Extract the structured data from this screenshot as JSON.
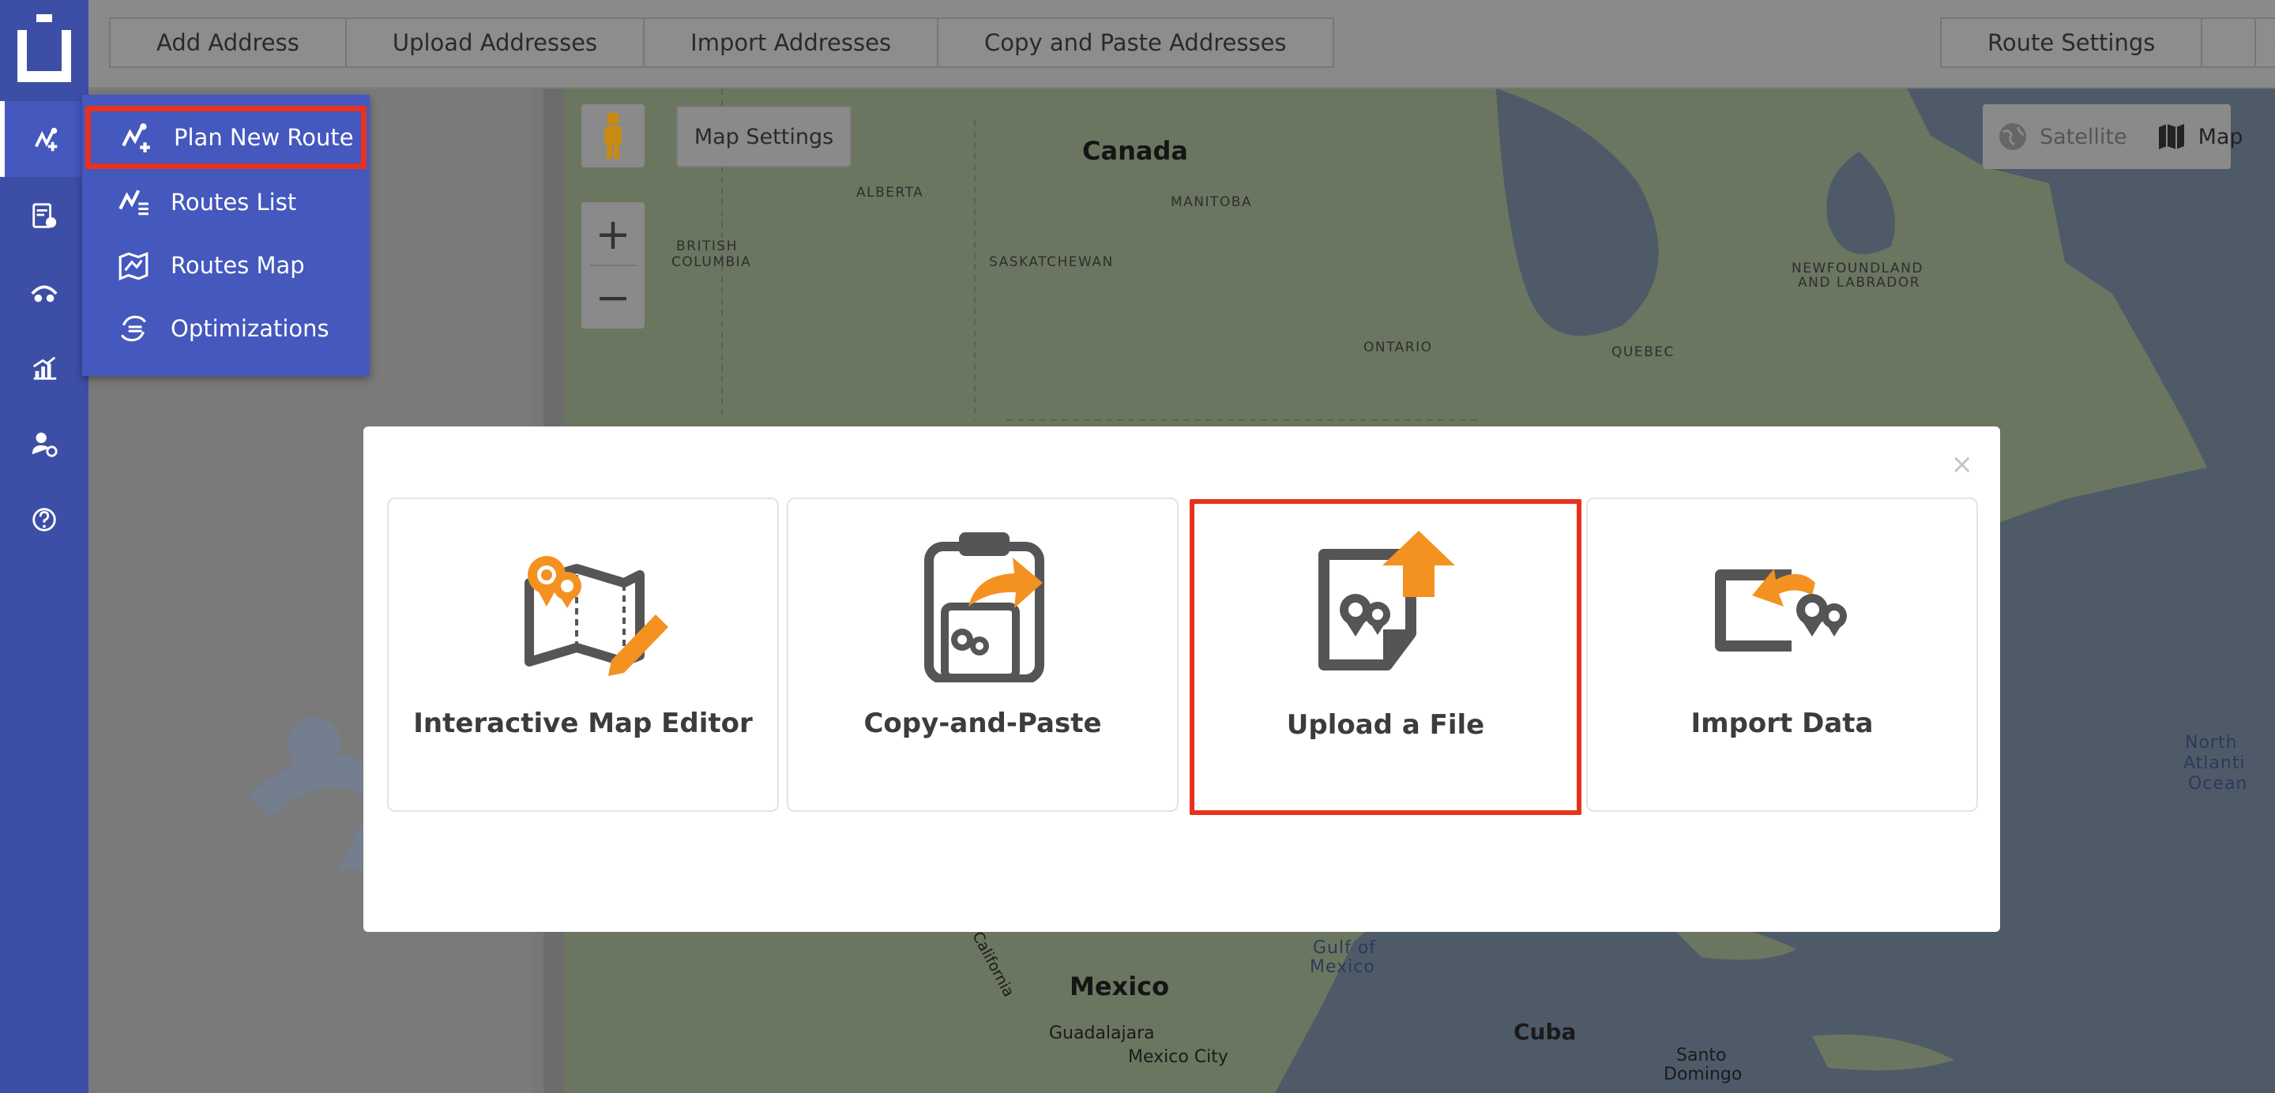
{
  "toolbar": {
    "add_address": "Add Address",
    "upload_addresses": "Upload Addresses",
    "import_addresses": "Import Addresses",
    "copy_paste_addresses": "Copy and Paste Addresses",
    "route_settings": "Route Settings",
    "lightning_icon": "lightning-icon"
  },
  "sidebar": {
    "logo_icon": "route4me-logo-icon",
    "items": [
      {
        "icon": "routes-icon",
        "active": true
      },
      {
        "icon": "address-book-icon",
        "active": false
      },
      {
        "icon": "drivers-icon",
        "active": false
      },
      {
        "icon": "analytics-icon",
        "active": false
      },
      {
        "icon": "user-settings-icon",
        "active": false
      },
      {
        "icon": "help-icon",
        "active": false
      }
    ]
  },
  "dropdown": {
    "items": [
      {
        "label": "Plan New Route",
        "icon": "plan-route-icon",
        "highlighted": true
      },
      {
        "label": "Routes List",
        "icon": "routes-list-icon",
        "highlighted": false
      },
      {
        "label": "Routes Map",
        "icon": "routes-map-icon",
        "highlighted": false
      },
      {
        "label": "Optimizations",
        "icon": "optimizations-icon",
        "highlighted": false
      }
    ]
  },
  "map": {
    "settings_label": "Map Settings",
    "zoom_in": "+",
    "zoom_out": "−",
    "type_satellite": "Satellite",
    "type_map": "Map",
    "labels": {
      "canada": "Canada",
      "alberta": "ALBERTA",
      "manitoba": "MANITOBA",
      "british_columbia_1": "BRITISH",
      "british_columbia_2": "COLUMBIA",
      "saskatchewan": "SASKATCHEWAN",
      "ontario": "ONTARIO",
      "quebec": "QUEBEC",
      "newfoundland_1": "NEWFOUNDLAND",
      "newfoundland_2": "AND LABRADOR",
      "north_atlantic_1": "North",
      "north_atlantic_2": "Atlanti",
      "north_atlantic_3": "Ocean",
      "mexico": "Mexico",
      "gulf_1": "Gulf of",
      "gulf_2": "Mexico",
      "guadalajara": "Guadalajara",
      "mexico_city": "Mexico City",
      "cuba": "Cuba",
      "santo_1": "Santo",
      "santo_2": "Domingo",
      "california": "California"
    }
  },
  "modal": {
    "close": "×",
    "cards": [
      {
        "label": "Interactive Map Editor",
        "icon": "map-editor-icon",
        "selected": false
      },
      {
        "label": "Copy-and-Paste",
        "icon": "clipboard-paste-icon",
        "selected": false
      },
      {
        "label": "Upload a File",
        "icon": "file-upload-icon",
        "selected": true
      },
      {
        "label": "Import Data",
        "icon": "import-data-icon",
        "selected": false
      }
    ]
  },
  "colors": {
    "sidebar": "#3d4ea6",
    "accent_orange": "#f39221",
    "highlight_red": "#e8321e",
    "icon_gray": "#555555"
  }
}
